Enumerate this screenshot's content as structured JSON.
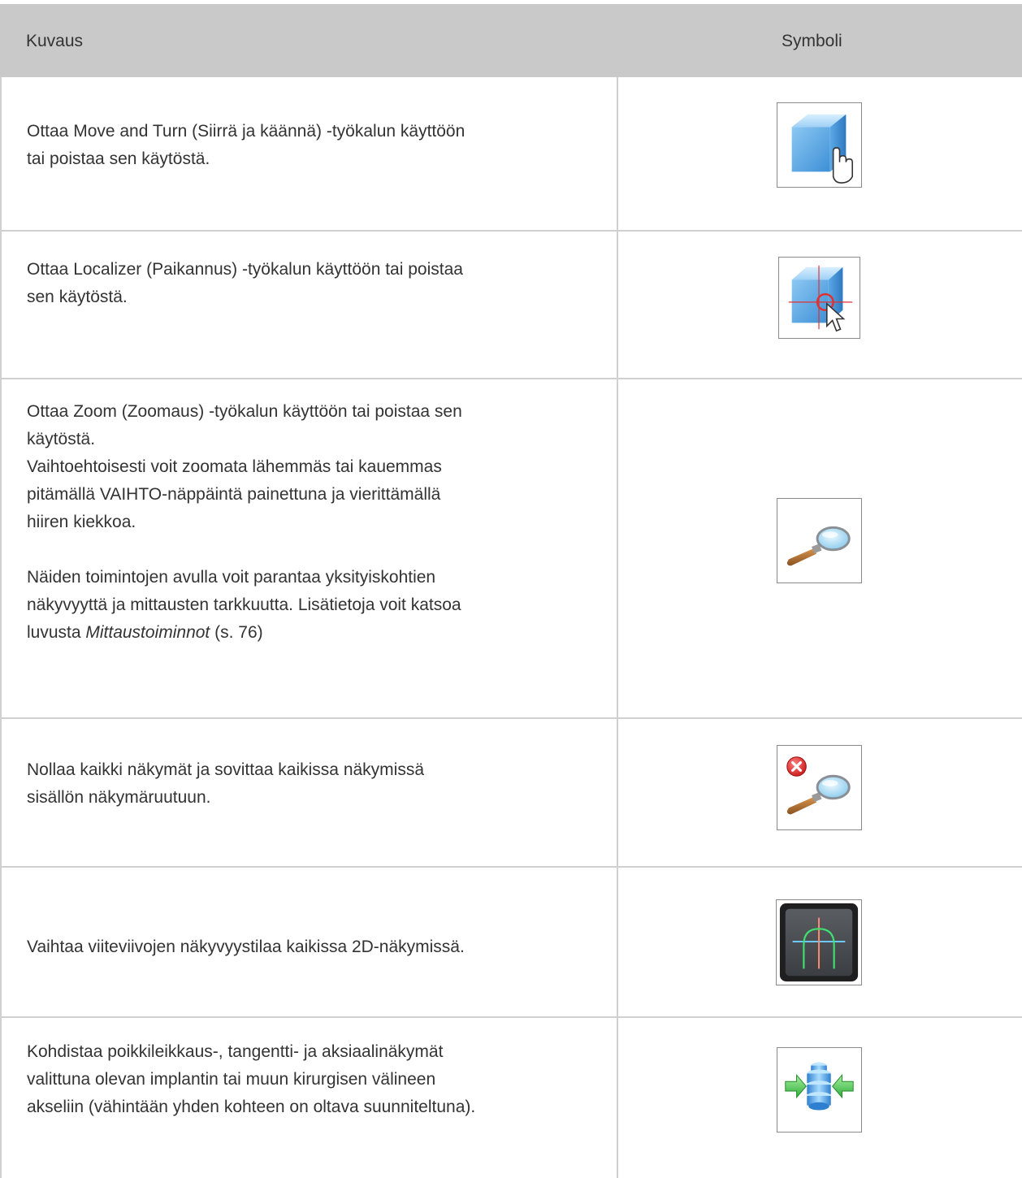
{
  "table": {
    "headers": {
      "description": "Kuvaus",
      "symbol": "Symboli"
    },
    "rows": [
      {
        "icon": "move-and-turn-icon",
        "lines": [
          "Ottaa Move and Turn (Siirrä ja käännä) -työkalun käyttöön",
          "tai poistaa sen käytöstä."
        ]
      },
      {
        "icon": "localizer-icon",
        "lines": [
          "Ottaa Localizer  (Paikannus) -työkalun käyttöön tai poistaa",
          "sen käytöstä."
        ]
      },
      {
        "icon": "zoom-icon",
        "lines": [
          "Ottaa Zoom (Zoomaus) -työkalun käyttöön tai poistaa sen",
          "käytöstä.",
          "Vaihtoehtoisesti voit zoomata lähemmäs tai kauemmas",
          "pitämällä VAIHTO-näppäintä painettuna ja  vierittämällä",
          "hiiren kiekkoa."
        ],
        "extra": {
          "line1": "Näiden toimintojen avulla voit parantaa yksityiskohtien",
          "line2": "näkyvyyttä ja mittausten tarkkuutta. Lisätietoja voit katsoa",
          "prefix": "luvusta ",
          "link": "Mittaustoiminnot",
          "suffix": " (s. 76)"
        }
      },
      {
        "icon": "reset-zoom-icon",
        "lines": [
          "Nollaa kaikki näkymät ja sovittaa kaikissa näkymissä",
          "sisällön näkymäruutuun."
        ]
      },
      {
        "icon": "reference-lines-icon",
        "lines": [
          "Vaihtaa viiteviivojen näkyvyystilaa kaikissa 2D-näkymissä."
        ]
      },
      {
        "icon": "align-views-icon",
        "lines": [
          "Kohdistaa poikkileikkaus-, tangentti- ja aksiaalinäkymät",
          "valittuna olevan implantin tai muun kirurgisen välineen",
          "akseliin (vähintään yhden kohteen on oltava suunniteltuna)."
        ]
      }
    ]
  }
}
